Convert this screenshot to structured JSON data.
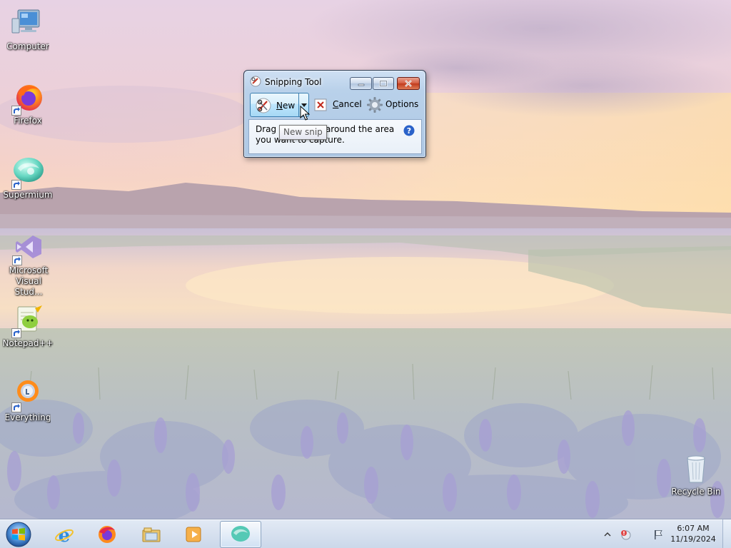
{
  "desktop": {
    "icons": [
      {
        "label": "Computer",
        "icon": "computer-monitor-icon",
        "shortcut": false
      },
      {
        "label": "Firefox",
        "icon": "firefox-icon",
        "shortcut": true
      },
      {
        "label": "Supermium",
        "icon": "supermium-icon",
        "shortcut": true
      },
      {
        "label": "Microsoft Visual Stud...",
        "icon": "visual-studio-icon",
        "shortcut": true
      },
      {
        "label": "Notepad++",
        "icon": "notepad-plus-plus-icon",
        "shortcut": true
      },
      {
        "label": "Everything",
        "icon": "everything-search-icon",
        "shortcut": true
      },
      {
        "label": "Recycle Bin",
        "icon": "recycle-bin-icon",
        "shortcut": false
      }
    ]
  },
  "snipping_tool": {
    "title": "Snipping Tool",
    "new_label": "New",
    "cancel_label": "Cancel",
    "options_label": "Options",
    "hint": "Drag the cursor around the area you want to capture.",
    "tooltip": "New snip"
  },
  "taskbar": {
    "pinned": [
      "internet-explorer-icon",
      "firefox-icon",
      "file-explorer-icon",
      "media-player-icon",
      "supermium-icon"
    ],
    "active": "supermium-icon",
    "clock": {
      "time": "6:07 AM",
      "date": "11/19/2024"
    }
  },
  "colors": {
    "titlebar": "#b9d1ea",
    "close_button": "#c13a1c",
    "taskbar": "#dbe6f3"
  }
}
